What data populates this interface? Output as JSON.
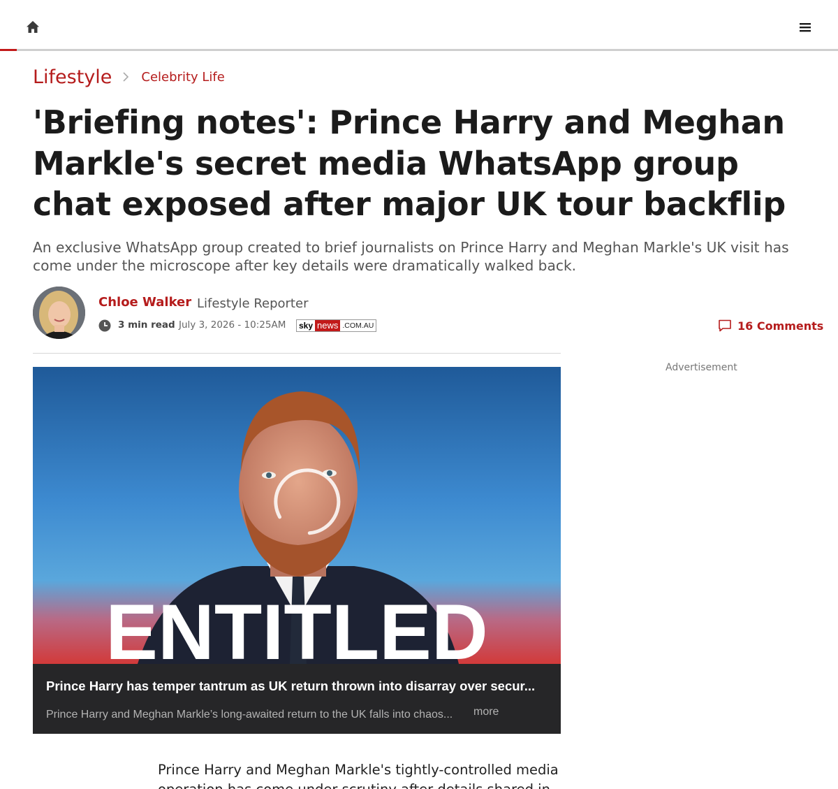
{
  "nav": {
    "home_icon": "home-icon",
    "menu_icon": "hamburger-menu-icon"
  },
  "breadcrumb": {
    "section": "Lifestyle",
    "subsection": "Celebrity Life",
    "separator_icon": "chevron-right-icon"
  },
  "article": {
    "headline": "'Briefing notes': Prince Harry and Meghan Markle's secret media WhatsApp group chat exposed after major UK tour backflip",
    "standfirst": "An exclusive WhatsApp group created to brief journalists on Prince Harry and Meghan Markle's UK visit has come under the microscope after key details were dramatically walked back.",
    "author": {
      "name": "Chloe Walker",
      "role": "Lifestyle Reporter"
    },
    "read_time": "3 min read",
    "date": "July 3, 2026 - 10:25AM",
    "source_logo": {
      "sky": "sky",
      "news": "news",
      "domain": ".COM.AU"
    },
    "comments": "16 Comments",
    "body_first_line": "Prince Harry and Meghan Markle's tightly-controlled media",
    "body_second_line": "operation has come under scrutiny after details shared in an"
  },
  "advertisement": {
    "label": "Advertisement"
  },
  "video": {
    "overlay_text": "ENTITLED",
    "title": "Prince Harry has temper tantrum as UK return thrown into disarray over secur...",
    "description": "Prince Harry and Meghan Markle’s long-awaited return to the UK falls into chaos...",
    "more_label": "more"
  },
  "colors": {
    "accent": "#b51c1c",
    "caption_bg": "#262628"
  }
}
